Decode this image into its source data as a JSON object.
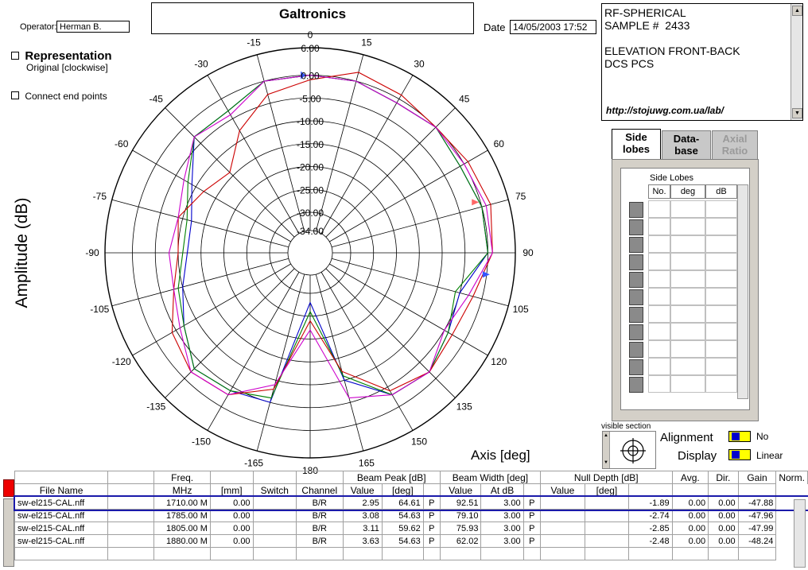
{
  "header": {
    "operator_label": "Operator:",
    "operator_value": "Herman B.",
    "title": "Galtronics",
    "date_label": "Date",
    "date_value": "14/05/2003 17:52"
  },
  "info": {
    "lines": "RF-SPHERICAL\nSAMPLE #  2433\n\nELEVATION FRONT-BACK\nDCS PCS",
    "url": "http://stojuwg.com.ua/lab/"
  },
  "options": {
    "representation_label": "Representation",
    "representation_value": "Original [clockwise]",
    "connect_label": "Connect end points"
  },
  "tabs": [
    {
      "label": "Side\nlobes",
      "active": true
    },
    {
      "label": "Data-\nbase",
      "active": false
    },
    {
      "label": "Axial\nRatio",
      "active": false
    }
  ],
  "side_lobes": {
    "title": "Side Lobes",
    "columns": [
      "No.",
      "deg",
      "dB"
    ]
  },
  "visible_section": {
    "label": "visible section",
    "alignment_label": "Alignment",
    "alignment_value": "No",
    "display_label": "Display",
    "display_value": "Linear"
  },
  "chart_data": {
    "type": "polar-line",
    "ylabel": "Amplitude (dB)",
    "xlabel": "Axis  [deg]",
    "angle_ticks": [
      "0",
      "15",
      "30",
      "45",
      "60",
      "75",
      "90",
      "105",
      "120",
      "135",
      "150",
      "165",
      "180",
      "-165",
      "-150",
      "-135",
      "-120",
      "-105",
      "-90",
      "-75",
      "-60",
      "-45",
      "-30",
      "-15"
    ],
    "radial_ticks": [
      "6.00",
      "0.00",
      "-5.00",
      "-10.00",
      "-15.00",
      "-20.00",
      "-25.00",
      "-30.00",
      "-34.00"
    ],
    "rlim": [
      -34,
      6
    ],
    "colors": {
      "series1": "#0000cc",
      "series2": "#008000",
      "series3": "#cc0000",
      "series4": "#cc00cc",
      "grid": "#000000"
    },
    "series": [
      {
        "color": "#0000cc",
        "points": [
          [
            -180,
            -28
          ],
          [
            -165,
            -5
          ],
          [
            -150,
            -4
          ],
          [
            -135,
            -3
          ],
          [
            -120,
            -7
          ],
          [
            -105,
            -10
          ],
          [
            -90,
            -12
          ],
          [
            -75,
            -12
          ],
          [
            -60,
            -9
          ],
          [
            -45,
            -3
          ],
          [
            -30,
            -3
          ],
          [
            -15,
            0
          ],
          [
            0,
            0
          ],
          [
            15,
            0
          ],
          [
            30,
            -1
          ],
          [
            45,
            0
          ],
          [
            60,
            -1
          ],
          [
            75,
            0
          ],
          [
            90,
            0
          ],
          [
            105,
            -5
          ],
          [
            120,
            -4
          ],
          [
            135,
            -2
          ],
          [
            150,
            -3
          ],
          [
            165,
            -10
          ],
          [
            180,
            -28
          ]
        ]
      },
      {
        "color": "#008000",
        "points": [
          [
            -180,
            -26
          ],
          [
            -165,
            -6
          ],
          [
            -150,
            -4
          ],
          [
            -135,
            -3
          ],
          [
            -120,
            -7
          ],
          [
            -105,
            -9
          ],
          [
            -90,
            -11
          ],
          [
            -75,
            -11
          ],
          [
            -60,
            -8
          ],
          [
            -45,
            -3
          ],
          [
            -30,
            -3
          ],
          [
            -15,
            0
          ],
          [
            0,
            0
          ],
          [
            15,
            0
          ],
          [
            30,
            -1
          ],
          [
            45,
            0
          ],
          [
            60,
            -1
          ],
          [
            75,
            0
          ],
          [
            90,
            0
          ],
          [
            105,
            -6
          ],
          [
            120,
            -4
          ],
          [
            135,
            -2
          ],
          [
            150,
            -3
          ],
          [
            165,
            -11
          ],
          [
            180,
            -26
          ]
        ]
      },
      {
        "color": "#cc0000",
        "points": [
          [
            -180,
            -24
          ],
          [
            -165,
            -8
          ],
          [
            -150,
            -3
          ],
          [
            -135,
            -2
          ],
          [
            -120,
            -4
          ],
          [
            -105,
            -8
          ],
          [
            -90,
            -10
          ],
          [
            -75,
            -9
          ],
          [
            -60,
            -12
          ],
          [
            -45,
            -14
          ],
          [
            -30,
            -8
          ],
          [
            -15,
            -3
          ],
          [
            0,
            -1
          ],
          [
            15,
            2
          ],
          [
            30,
            1
          ],
          [
            45,
            0
          ],
          [
            60,
            1
          ],
          [
            75,
            2
          ],
          [
            90,
            1
          ],
          [
            105,
            -2
          ],
          [
            120,
            -3
          ],
          [
            135,
            -2
          ],
          [
            150,
            -4
          ],
          [
            165,
            -12
          ],
          [
            180,
            -24
          ]
        ]
      },
      {
        "color": "#cc00cc",
        "points": [
          [
            -180,
            -22
          ],
          [
            -165,
            -9
          ],
          [
            -150,
            -3
          ],
          [
            -135,
            -2
          ],
          [
            -120,
            -6
          ],
          [
            -105,
            -8
          ],
          [
            -90,
            -8
          ],
          [
            -75,
            -9
          ],
          [
            -60,
            -7
          ],
          [
            -45,
            -3
          ],
          [
            -30,
            -4
          ],
          [
            -15,
            0
          ],
          [
            0,
            0
          ],
          [
            15,
            0
          ],
          [
            30,
            -1
          ],
          [
            45,
            0
          ],
          [
            60,
            0
          ],
          [
            75,
            1
          ],
          [
            90,
            1
          ],
          [
            105,
            -3
          ],
          [
            120,
            -5
          ],
          [
            135,
            -2
          ],
          [
            150,
            -3
          ],
          [
            165,
            -6
          ],
          [
            180,
            -22
          ]
        ]
      }
    ]
  },
  "table": {
    "headers_top": [
      "",
      "",
      "Freq.",
      "",
      "",
      "",
      "Beam Peak [dB]",
      "Beam Width [deg]",
      "Null Depth [dB]",
      "Avg.",
      "Dir.",
      "Gain",
      "Norm."
    ],
    "headers": [
      "File Name",
      "",
      "MHz",
      "[mm]",
      "Switch",
      "Channel",
      "Value",
      "[deg]",
      "",
      "Value",
      "At dB",
      "",
      "Value",
      "[deg]",
      "",
      "",
      "",
      ""
    ],
    "rows": [
      [
        "sw-el215-CAL.nff",
        "",
        "1710.00 M",
        "0.00",
        "",
        "B/R",
        "2.95",
        "64.61",
        "P",
        "92.51",
        "3.00",
        "P",
        "",
        "",
        "-1.89",
        "0.00",
        "0.00",
        "-47.88"
      ],
      [
        "sw-el215-CAL.nff",
        "",
        "1785.00 M",
        "0.00",
        "",
        "B/R",
        "3.08",
        "54.63",
        "P",
        "79.10",
        "3.00",
        "P",
        "",
        "",
        "-2.74",
        "0.00",
        "0.00",
        "-47.96"
      ],
      [
        "sw-el215-CAL.nff",
        "",
        "1805.00 M",
        "0.00",
        "",
        "B/R",
        "3.11",
        "59.62",
        "P",
        "75.93",
        "3.00",
        "P",
        "",
        "",
        "-2.85",
        "0.00",
        "0.00",
        "-47.99"
      ],
      [
        "sw-el215-CAL.nff",
        "",
        "1880.00 M",
        "0.00",
        "",
        "B/R",
        "3.63",
        "54.63",
        "P",
        "62.02",
        "3.00",
        "P",
        "",
        "",
        "-2.48",
        "0.00",
        "0.00",
        "-48.24"
      ]
    ]
  }
}
